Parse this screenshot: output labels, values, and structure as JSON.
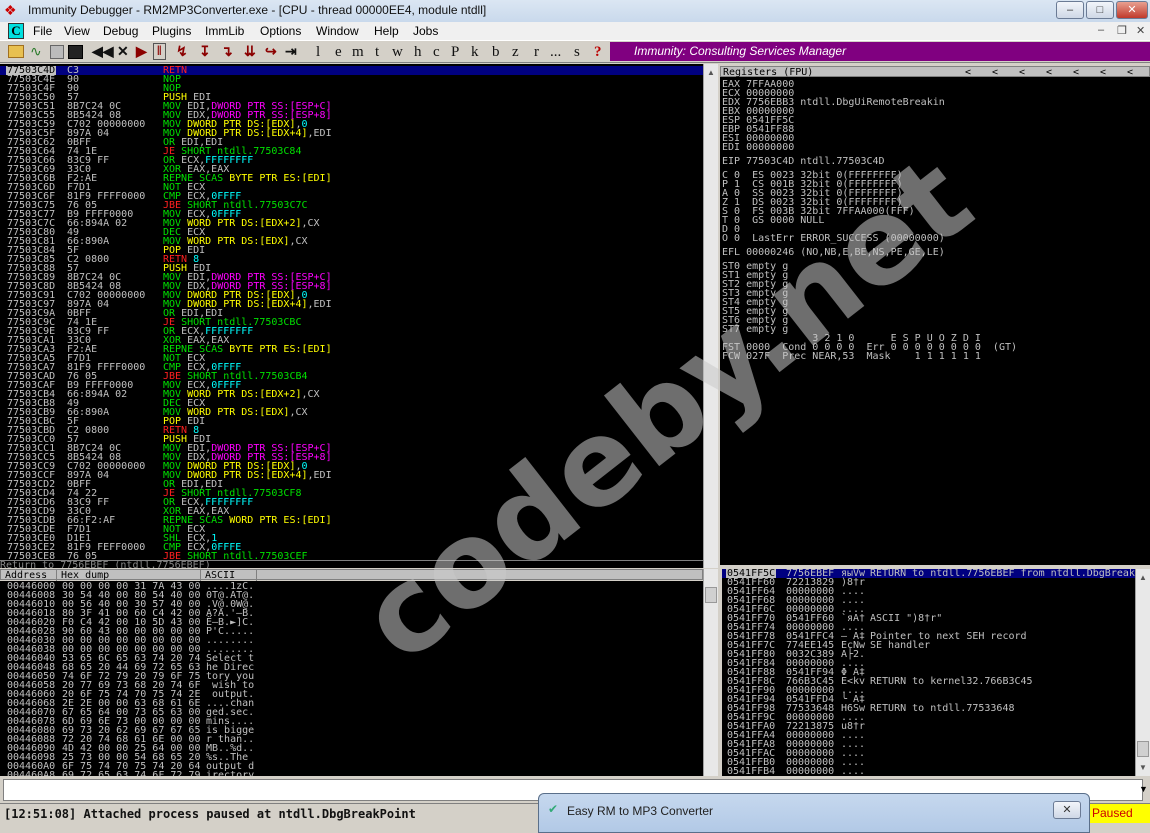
{
  "window": {
    "title": "Immunity Debugger - RM2MP3Converter.exe - [CPU - thread 00000EE4, module ntdll]",
    "minimize": "–",
    "maximize": "□",
    "close": "✕"
  },
  "menu": {
    "cpu_badge": "C",
    "items": [
      "File",
      "View",
      "Debug",
      "Plugins",
      "ImmLib",
      "Options",
      "Window",
      "Help",
      "Jobs"
    ]
  },
  "toolbar": {
    "icons": [
      "open-icon",
      "attach-icon",
      "close-window-icon",
      "restart-icon",
      "rewind-icon",
      "close-icon",
      "run-icon",
      "pause-icon",
      "step-into-icon",
      "step-over-icon",
      "trace-into-icon",
      "trace-over-icon",
      "execute-till-return-icon",
      "goto-icon"
    ],
    "glyphs": [
      "◀◀",
      "✕",
      "▶",
      "‖",
      "↯",
      "↧",
      "↴",
      "⇊",
      "↪",
      "⇥"
    ],
    "letters": [
      "l",
      "e",
      "m",
      "t",
      "w",
      "h",
      "c",
      "P",
      "k",
      "b",
      "z",
      "r",
      "...",
      "s",
      "?"
    ],
    "banner": "Immunity: Consulting Services Manager"
  },
  "disasm": {
    "rows": [
      [
        "77503C4D",
        "C3",
        "{r}RETN"
      ],
      [
        "77503C4E",
        "90",
        "{g}NOP"
      ],
      [
        "77503C4F",
        "90",
        "{g}NOP"
      ],
      [
        "77503C50",
        "57",
        "{y}PUSH {w}EDI"
      ],
      [
        "77503C51",
        "8B7C24 0C",
        "{g}MOV {w}EDI,{m}DWORD PTR SS:[ESP+C]"
      ],
      [
        "77503C55",
        "8B5424 08",
        "{g}MOV {w}EDX,{m}DWORD PTR SS:[ESP+8]"
      ],
      [
        "77503C59",
        "C702 00000000",
        "{g}MOV {y}DWORD PTR DS:[EDX]{w},{c}0"
      ],
      [
        "77503C5F",
        "897A 04",
        "{g}MOV {y}DWORD PTR DS:[EDX+4]{w},EDI"
      ],
      [
        "77503C62",
        "0BFF",
        "{g}OR {w}EDI,EDI"
      ],
      [
        "77503C64",
        "74 1E",
        "{r}JE {g}SHORT ntdll.77503C84"
      ],
      [
        "77503C66",
        "83C9 FF",
        "{g}OR {w}ECX,{c}FFFFFFFF"
      ],
      [
        "77503C69",
        "33C0",
        "{g}XOR {w}EAX,EAX"
      ],
      [
        "77503C6B",
        "F2:AE",
        "{g}REPNE SCAS {y}BYTE PTR ES:[EDI]"
      ],
      [
        "77503C6D",
        "F7D1",
        "{g}NOT {w}ECX"
      ],
      [
        "77503C6F",
        "81F9 FFFF0000",
        "{g}CMP {w}ECX,{c}0FFFF"
      ],
      [
        "77503C75",
        "76 05",
        "{r}JBE {g}SHORT ntdll.77503C7C"
      ],
      [
        "77503C77",
        "B9 FFFF0000",
        "{g}MOV {w}ECX,{c}0FFFF"
      ],
      [
        "77503C7C",
        "66:894A 02",
        "{g}MOV {y}WORD PTR DS:[EDX+2]{w},CX"
      ],
      [
        "77503C80",
        "49",
        "{g}DEC {w}ECX"
      ],
      [
        "77503C81",
        "66:890A",
        "{g}MOV {y}WORD PTR DS:[EDX]{w},CX"
      ],
      [
        "77503C84",
        "5F",
        "{y}POP {w}EDI"
      ],
      [
        "77503C85",
        "C2 0800",
        "{r}RETN {c}8"
      ],
      [
        "77503C88",
        "57",
        "{y}PUSH {w}EDI"
      ],
      [
        "77503C89",
        "8B7C24 0C",
        "{g}MOV {w}EDI,{m}DWORD PTR SS:[ESP+C]"
      ],
      [
        "77503C8D",
        "8B5424 08",
        "{g}MOV {w}EDX,{m}DWORD PTR SS:[ESP+8]"
      ],
      [
        "77503C91",
        "C702 00000000",
        "{g}MOV {y}DWORD PTR DS:[EDX]{w},{c}0"
      ],
      [
        "77503C97",
        "897A 04",
        "{g}MOV {y}DWORD PTR DS:[EDX+4]{w},EDI"
      ],
      [
        "77503C9A",
        "0BFF",
        "{g}OR {w}EDI,EDI"
      ],
      [
        "77503C9C",
        "74 1E",
        "{r}JE {g}SHORT ntdll.77503CBC"
      ],
      [
        "77503C9E",
        "83C9 FF",
        "{g}OR {w}ECX,{c}FFFFFFFF"
      ],
      [
        "77503CA1",
        "33C0",
        "{g}XOR {w}EAX,EAX"
      ],
      [
        "77503CA3",
        "F2:AE",
        "{g}REPNE SCAS {y}BYTE PTR ES:[EDI]"
      ],
      [
        "77503CA5",
        "F7D1",
        "{g}NOT {w}ECX"
      ],
      [
        "77503CA7",
        "81F9 FFFF0000",
        "{g}CMP {w}ECX,{c}0FFFF"
      ],
      [
        "77503CAD",
        "76 05",
        "{r}JBE {g}SHORT ntdll.77503CB4"
      ],
      [
        "77503CAF",
        "B9 FFFF0000",
        "{g}MOV {w}ECX,{c}0FFFF"
      ],
      [
        "77503CB4",
        "66:894A 02",
        "{g}MOV {y}WORD PTR DS:[EDX+2]{w},CX"
      ],
      [
        "77503CB8",
        "49",
        "{g}DEC {w}ECX"
      ],
      [
        "77503CB9",
        "66:890A",
        "{g}MOV {y}WORD PTR DS:[EDX]{w},CX"
      ],
      [
        "77503CBC",
        "5F",
        "{y}POP {w}EDI"
      ],
      [
        "77503CBD",
        "C2 0800",
        "{r}RETN {c}8"
      ],
      [
        "77503CC0",
        "57",
        "{y}PUSH {w}EDI"
      ],
      [
        "77503CC1",
        "8B7C24 0C",
        "{g}MOV {w}EDI,{m}DWORD PTR SS:[ESP+C]"
      ],
      [
        "77503CC5",
        "8B5424 08",
        "{g}MOV {w}EDX,{m}DWORD PTR SS:[ESP+8]"
      ],
      [
        "77503CC9",
        "C702 00000000",
        "{g}MOV {y}DWORD PTR DS:[EDX]{w},{c}0"
      ],
      [
        "77503CCF",
        "897A 04",
        "{g}MOV {y}DWORD PTR DS:[EDX+4]{w},EDI"
      ],
      [
        "77503CD2",
        "0BFF",
        "{g}OR {w}EDI,EDI"
      ],
      [
        "77503CD4",
        "74 22",
        "{r}JE {g}SHORT ntdll.77503CF8"
      ],
      [
        "77503CD6",
        "83C9 FF",
        "{g}OR {w}ECX,{c}FFFFFFFF"
      ],
      [
        "77503CD9",
        "33C0",
        "{g}XOR {w}EAX,EAX"
      ],
      [
        "77503CDB",
        "66:F2:AF",
        "{g}REPNE SCAS {y}WORD PTR ES:[EDI]"
      ],
      [
        "77503CDE",
        "F7D1",
        "{g}NOT {w}ECX"
      ],
      [
        "77503CE0",
        "D1E1",
        "{g}SHL {w}ECX,{c}1"
      ],
      [
        "77503CE2",
        "81F9 FEFF0000",
        "{g}CMP {w}ECX,{c}0FFFE"
      ],
      [
        "77503CE8",
        "76 05",
        "{r}JBE {g}SHORT ntdll.77503CEF"
      ]
    ],
    "info_line": "Return to 7756EBEF (ntdll.7756EBEF)"
  },
  "registers": {
    "title": "Registers (FPU)",
    "arrows": [
      "<",
      "<",
      "<",
      "<",
      "<",
      "<",
      "<"
    ],
    "lines": [
      "EAX 7FFAA000",
      "ECX 00000000",
      "EDX 7756EBB3 ntdll.DbgUiRemoteBreakin",
      "EBX 00000000",
      "ESP 0541FF5C",
      "EBP 0541FF88",
      "ESI 00000000",
      "EDI 00000000",
      "",
      "EIP 77503C4D ntdll.77503C4D",
      "",
      "C 0  ES 0023 32bit 0(FFFFFFFF)",
      "P 1  CS 001B 32bit 0(FFFFFFFF)",
      "A 0  SS 0023 32bit 0(FFFFFFFF)",
      "Z 1  DS 0023 32bit 0(FFFFFFFF)",
      "S 0  FS 003B 32bit 7FFAA000(FFF)",
      "T 0  GS 0000 NULL",
      "D 0",
      "O 0  LastErr ERROR_SUCCESS (00000000)",
      "",
      "EFL 00000246 (NO,NB,E,BE,NS,PE,GE,LE)",
      "",
      "ST0 empty g",
      "ST1 empty g",
      "ST2 empty g",
      "ST3 empty g",
      "ST4 empty g",
      "ST5 empty g",
      "ST6 empty g",
      "ST7 empty g",
      "               3 2 1 0      E S P U O Z D I",
      "FST 0000  Cond 0 0 0 0  Err 0 0 0 0 0 0 0 0  (GT)",
      "FCW 027F  Prec NEAR,53  Mask    1 1 1 1 1 1"
    ]
  },
  "dump": {
    "headers": [
      "Address",
      "Hex dump",
      "ASCII"
    ],
    "rows": [
      [
        "00446000",
        "00 00 00 00 31 7A 43 00",
        "....1zC."
      ],
      [
        "00446008",
        "30 54 40 00 80 54 40 00",
        "0T@.АT@."
      ],
      [
        "00446010",
        "00 56 40 00 30 57 40 00",
        ".V@.0W@."
      ],
      [
        "00446018",
        "80 3F 41 00 60 C4 42 00",
        "А?A.'—B."
      ],
      [
        "00446020",
        "F0 C4 42 00 10 5D 43 00",
        "Ё—B.►]C."
      ],
      [
        "00446028",
        "90 60 43 00 00 00 00 00",
        "P'C....."
      ],
      [
        "00446030",
        "00 00 00 00 00 00 00 00",
        "........"
      ],
      [
        "00446038",
        "00 00 00 00 00 00 00 00",
        "........"
      ],
      [
        "00446040",
        "53 65 6C 65 63 74 20 74",
        "Select t"
      ],
      [
        "00446048",
        "68 65 20 44 69 72 65 63",
        "he Direc"
      ],
      [
        "00446050",
        "74 6F 72 79 20 79 6F 75",
        "tory you"
      ],
      [
        "00446058",
        "20 77 69 73 68 20 74 6F",
        " wish to"
      ],
      [
        "00446060",
        "20 6F 75 74 70 75 74 2E",
        " output."
      ],
      [
        "00446068",
        "2E 2E 00 00 63 68 61 6E",
        "....chan"
      ],
      [
        "00446070",
        "67 65 64 00 73 65 63 00",
        "ged.sec."
      ],
      [
        "00446078",
        "6D 69 6E 73 00 00 00 00",
        "mins...."
      ],
      [
        "00446080",
        "69 73 20 62 69 67 67 65",
        "is bigge"
      ],
      [
        "00446088",
        "72 20 74 68 61 6E 00 00",
        "r than.."
      ],
      [
        "00446090",
        "4D 42 00 00 25 64 00 00",
        "MB..%d.."
      ],
      [
        "00446098",
        "25 73 00 00 54 68 65 20",
        "%s..The "
      ],
      [
        "004460A0",
        "6F 75 74 70 75 74 20 64",
        "output d"
      ],
      [
        "004460A8",
        "69 72 65 63 74 6F 72 79",
        "irectory"
      ]
    ]
  },
  "stack": {
    "rows": [
      [
        "0541FF5C",
        "7756EBEF",
        "яыVw",
        "RETURN to ntdll.7756EBEF from ntdll.DbgBreakPoint"
      ],
      [
        "0541FF60",
        "72213829",
        ")8†r",
        ""
      ],
      [
        "0541FF64",
        "00000000",
        "....",
        ""
      ],
      [
        "0541FF68",
        "00000000",
        "....",
        ""
      ],
      [
        "0541FF6C",
        "00000000",
        "....",
        ""
      ],
      [
        "0541FF70",
        "0541FF60",
        "`яA†",
        "ASCII \")8†r\""
      ],
      [
        "0541FF74",
        "00000000",
        "....",
        ""
      ],
      [
        "0541FF78",
        "0541FFC4",
        "— A‡",
        "Pointer to next SEH record"
      ],
      [
        "0541FF7C",
        "774EE145",
        "EсNw",
        "SE handler"
      ],
      [
        "0541FF80",
        "0032C389",
        "А├2.",
        ""
      ],
      [
        "0541FF84",
        "00000000",
        "....",
        ""
      ],
      [
        "0541FF88",
        "0541FF94",
        "Φ A‡",
        ""
      ],
      [
        "0541FF8C",
        "766B3C45",
        "E<kv",
        "RETURN to kernel32.766B3C45"
      ],
      [
        "0541FF90",
        "00000000",
        "....",
        ""
      ],
      [
        "0541FF94",
        "0541FFD4",
        "╰ A‡",
        ""
      ],
      [
        "0541FF98",
        "77533648",
        "H6Sw",
        "RETURN to ntdll.77533648"
      ],
      [
        "0541FF9C",
        "00000000",
        "....",
        ""
      ],
      [
        "0541FFA0",
        "72213875",
        "u8†r",
        ""
      ],
      [
        "0541FFA4",
        "00000000",
        "....",
        ""
      ],
      [
        "0541FFA8",
        "00000000",
        "....",
        ""
      ],
      [
        "0541FFAC",
        "00000000",
        "....",
        ""
      ],
      [
        "0541FFB0",
        "00000000",
        "....",
        ""
      ],
      [
        "0541FFB4",
        "00000000",
        "....",
        ""
      ]
    ]
  },
  "command": {
    "value": ""
  },
  "status": {
    "message": "[12:51:08] Attached process paused at ntdll.DbgBreakPoint",
    "state": "Paused"
  },
  "popup": {
    "title": "Easy RM to MP3 Converter",
    "close": "✕"
  },
  "watermark": "codeby.net"
}
